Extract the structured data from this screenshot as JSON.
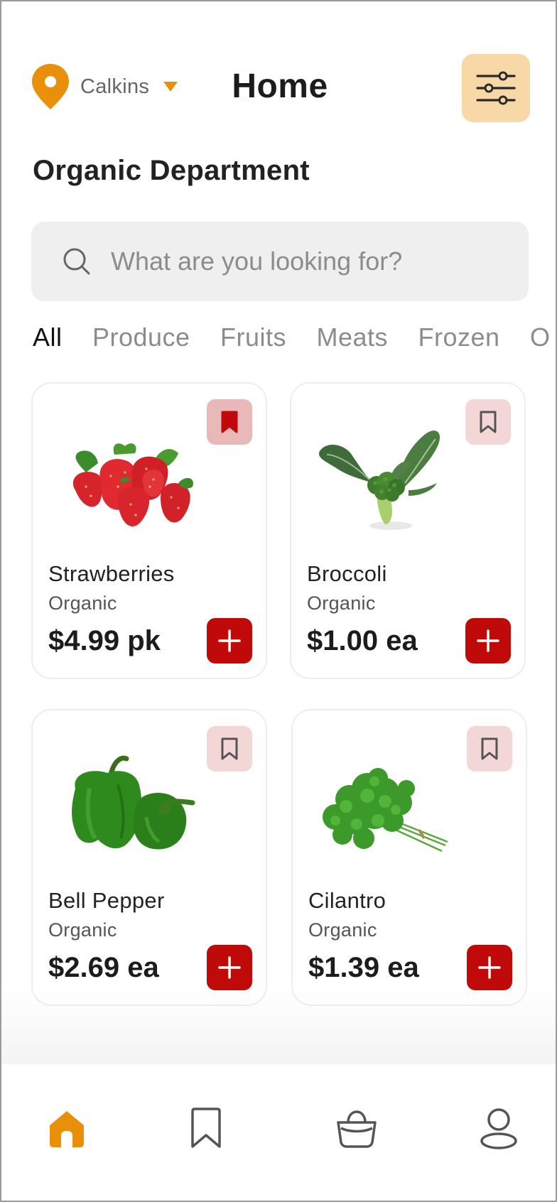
{
  "header": {
    "location": "Calkins",
    "title": "Home",
    "filter_icon": "sliders-icon"
  },
  "department": "Organic Department",
  "search": {
    "placeholder": "What are you looking for?",
    "value": ""
  },
  "tabs": [
    {
      "label": "All",
      "active": true
    },
    {
      "label": "Produce",
      "active": false
    },
    {
      "label": "Fruits",
      "active": false
    },
    {
      "label": "Meats",
      "active": false
    },
    {
      "label": "Frozen",
      "active": false
    }
  ],
  "products": [
    {
      "name": "Strawberries",
      "subtitle": "Organic",
      "price": "$4.99 pk",
      "bookmarked": true,
      "image": "strawberries-image"
    },
    {
      "name": "Broccoli",
      "subtitle": "Organic",
      "price": "$1.00 ea",
      "bookmarked": false,
      "image": "broccoli-image"
    },
    {
      "name": "Bell Pepper",
      "subtitle": "Organic",
      "price": "$2.69 ea",
      "bookmarked": false,
      "image": "bell-pepper-image"
    },
    {
      "name": "Cilantro",
      "subtitle": "Organic",
      "price": "$1.39 ea",
      "bookmarked": false,
      "image": "cilantro-image"
    }
  ],
  "nav": [
    {
      "icon": "home-icon",
      "active": true
    },
    {
      "icon": "bookmark-icon",
      "active": false
    },
    {
      "icon": "basket-icon",
      "active": false
    },
    {
      "icon": "profile-icon",
      "active": false
    }
  ],
  "colors": {
    "accent": "#e8900a",
    "primary_red": "#c00a0a",
    "filter_bg": "#f7d8a6",
    "bookmark_bg": "#f3d7d7",
    "search_bg": "#efefef"
  }
}
